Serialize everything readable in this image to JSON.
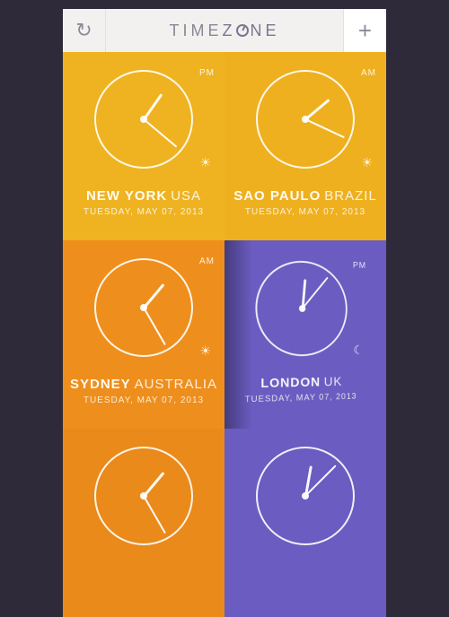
{
  "header": {
    "title_part1": "TIME",
    "title_part2": "Z",
    "title_part3": "NE",
    "refresh_label": "↻",
    "add_label": "+"
  },
  "tiles": [
    {
      "id": "new-york",
      "city": "NEW YORK",
      "country": "USA",
      "date": "TUESDAY, MAY 07, 2013",
      "ampm": "PM",
      "day": true,
      "hour_angle": 35,
      "minute_angle": 130,
      "bg": "#efb321"
    },
    {
      "id": "sao-paulo",
      "city": "SAO PAULO",
      "country": "BRAZIL",
      "date": "TUESDAY, MAY 07, 2013",
      "ampm": "AM",
      "day": true,
      "hour_angle": 50,
      "minute_angle": 115,
      "bg": "#eeb01f"
    },
    {
      "id": "sydney",
      "city": "SYDNEY",
      "country": "AUSTRALIA",
      "date": "TUESDAY, MAY 07, 2013",
      "ampm": "AM",
      "day": true,
      "hour_angle": 40,
      "minute_angle": 150,
      "bg": "#ee8f1d"
    },
    {
      "id": "london",
      "city": "LONDON",
      "country": "UK",
      "date": "TUESDAY, MAY 07, 2013",
      "ampm": "PM",
      "day": false,
      "hour_angle": 5,
      "minute_angle": 40,
      "bg": "#6a5cc0",
      "flip": true
    }
  ],
  "icons": {
    "sun": "☀",
    "moon": "☾"
  }
}
